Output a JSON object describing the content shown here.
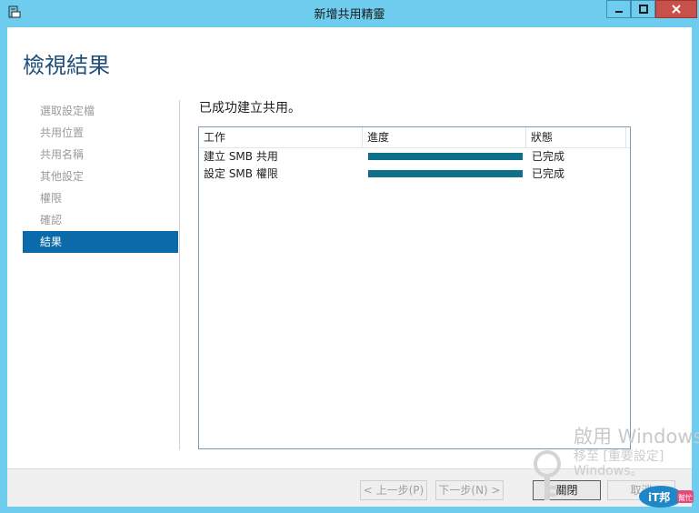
{
  "window": {
    "title": "新增共用精靈"
  },
  "page": {
    "title": "檢視結果"
  },
  "nav": {
    "items": [
      {
        "label": "選取設定檔",
        "active": false
      },
      {
        "label": "共用位置",
        "active": false
      },
      {
        "label": "共用名稱",
        "active": false
      },
      {
        "label": "其他設定",
        "active": false
      },
      {
        "label": "權限",
        "active": false
      },
      {
        "label": "確認",
        "active": false
      },
      {
        "label": "結果",
        "active": true
      }
    ]
  },
  "results": {
    "heading": "已成功建立共用。",
    "columns": [
      "工作",
      "進度",
      "狀態"
    ],
    "rows": [
      {
        "task": "建立 SMB 共用",
        "progress": 1.0,
        "status": "已完成"
      },
      {
        "task": "設定 SMB 權限",
        "progress": 1.0,
        "status": "已完成"
      }
    ]
  },
  "footer": {
    "prev_label": "< 上一步(P)",
    "next_label": "下一步(N) >",
    "close_label": "關閉",
    "cancel_label": "取消"
  },
  "watermark": {
    "line1": "啟用 Windows",
    "line2": "移至 [重要設定]",
    "line3": "Windows。",
    "badge": "iT邦幫忙"
  },
  "colors": {
    "titlebar": "#6ecdee",
    "accent": "#0b6aaa",
    "progress": "#0e6f88",
    "close_button": "#c7504b"
  }
}
